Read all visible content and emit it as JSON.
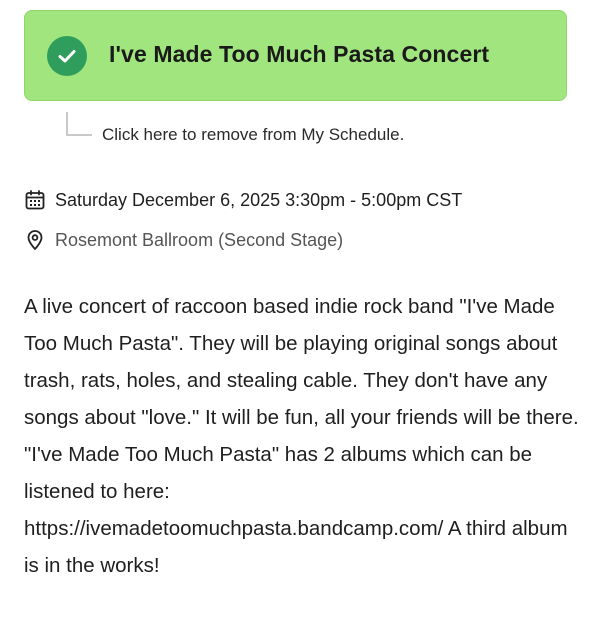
{
  "event": {
    "title": "I've Made Too Much Pasta Concert",
    "status_icon": "check-circle-icon",
    "remove_hint": "Click here to remove from My Schedule.",
    "datetime": "Saturday December 6, 2025 3:30pm - 5:00pm CST",
    "location": "Rosemont Ballroom (Second Stage)",
    "description": "A live concert of raccoon based indie rock band \"I've Made Too Much Pasta\". They will be playing original songs about trash, rats, holes, and stealing cable. They don't have any songs about \"love.\" It will be fun, all your friends will be there. \"I've Made Too Much Pasta\" has 2 albums which can be listened to here: https://ivemadetoomuchpasta.bandcamp.com/ A third album is in the works!"
  },
  "colors": {
    "banner_background": "#a1e57e",
    "check_circle": "#2f9e5c",
    "location_text": "#555555"
  }
}
